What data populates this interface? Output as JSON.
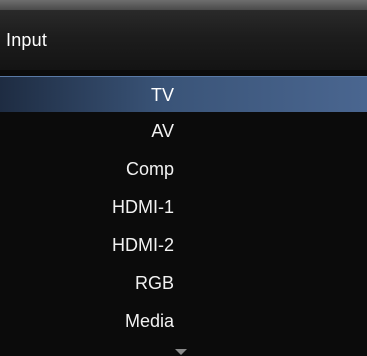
{
  "header": {
    "title": "Input"
  },
  "menu": {
    "items": [
      {
        "label": "TV",
        "selected": true
      },
      {
        "label": "AV",
        "selected": false
      },
      {
        "label": "Comp",
        "selected": false
      },
      {
        "label": "HDMI-1",
        "selected": false
      },
      {
        "label": "HDMI-2",
        "selected": false
      },
      {
        "label": "RGB",
        "selected": false
      },
      {
        "label": "Media",
        "selected": false
      }
    ]
  },
  "icons": {
    "scroll_indicator": "chevron-down-icon"
  },
  "colors": {
    "highlight": "#4a6690",
    "background": "#0b0b0b",
    "text": "#ffffff"
  }
}
